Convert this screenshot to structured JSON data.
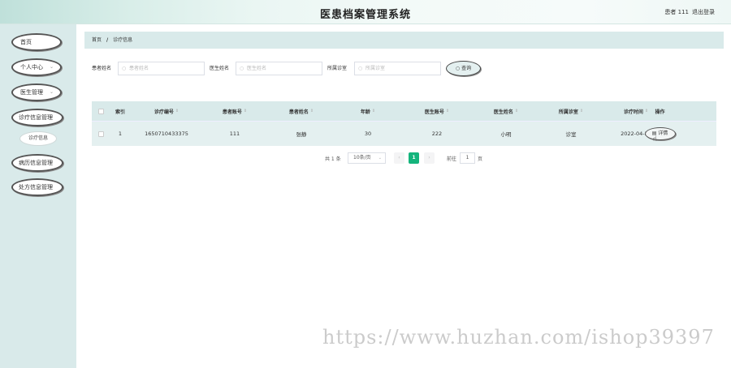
{
  "header": {
    "title": "医患档案管理系统",
    "user": "患者 111",
    "logout": "退出登录"
  },
  "sidebar": {
    "items": [
      {
        "label": "首页",
        "arrow": ""
      },
      {
        "label": "个人中心",
        "arrow": "⌄"
      },
      {
        "label": "医生管理",
        "arrow": "⌄"
      },
      {
        "label": "诊疗信息管理",
        "arrow": ""
      },
      {
        "label": "病历信息管理",
        "arrow": ""
      },
      {
        "label": "处方信息管理",
        "arrow": ""
      }
    ],
    "sub_item": "诊疗信息"
  },
  "breadcrumb": {
    "home": "首页",
    "sep": "/",
    "current": "诊疗信息"
  },
  "search": {
    "patient_name_label": "患者姓名",
    "patient_name_placeholder": "患者姓名",
    "doctor_name_label": "医生姓名",
    "doctor_name_placeholder": "医生姓名",
    "dept_label": "所属诊室",
    "dept_placeholder": "所属诊室",
    "button": "查询"
  },
  "table": {
    "headers": [
      "",
      "索引",
      "诊疗编号",
      "患者账号",
      "患者姓名",
      "年龄",
      "医生账号",
      "医生姓名",
      "所属诊室",
      "诊疗时间",
      "操作"
    ],
    "rows": [
      [
        "",
        "1",
        "1650710433375",
        "111",
        "张静",
        "30",
        "222",
        "小明",
        "诊室",
        "2022-04-24",
        "详情"
      ]
    ]
  },
  "pagination": {
    "total": "共 1 条",
    "page_size": "10条/页",
    "prev": "‹",
    "current": "1",
    "next": "›",
    "goto_label": "前往",
    "goto_value": "1",
    "page_suffix": "页"
  },
  "watermark": "https://www.huzhan.com/ishop39397"
}
